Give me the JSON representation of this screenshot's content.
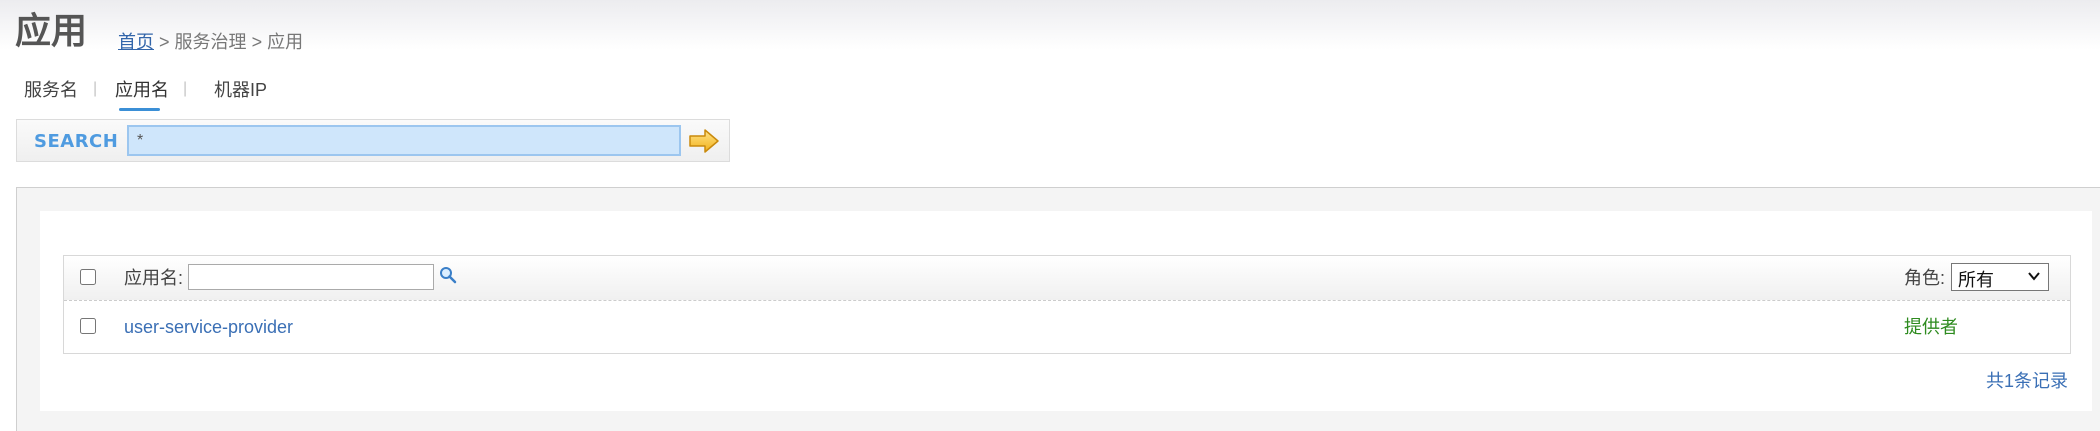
{
  "header": {
    "title": "应用",
    "breadcrumb": {
      "home": "首页",
      "sep1": ">",
      "section": "服务治理",
      "sep2": ">",
      "current": "应用"
    }
  },
  "tabs": [
    {
      "label": "服务名",
      "active": false
    },
    {
      "label": "应用名",
      "active": true
    },
    {
      "label": "机器IP",
      "active": false
    }
  ],
  "tab_separator": "|",
  "search": {
    "label": "SEARCH",
    "value": "*",
    "go_icon": "arrow-right-icon"
  },
  "table": {
    "filter_label": "应用名:",
    "filter_value": "",
    "filter_icon": "search-icon",
    "role_label": "角色:",
    "role_selected": "所有",
    "rows": [
      {
        "app": "user-service-provider",
        "role": "提供者"
      }
    ],
    "total": "共1条记录"
  },
  "colors": {
    "link": "#3a6fb5",
    "search_label": "#4f9be0",
    "role_provider": "#2e8b1f",
    "input_highlight": "#cfe6fb"
  }
}
